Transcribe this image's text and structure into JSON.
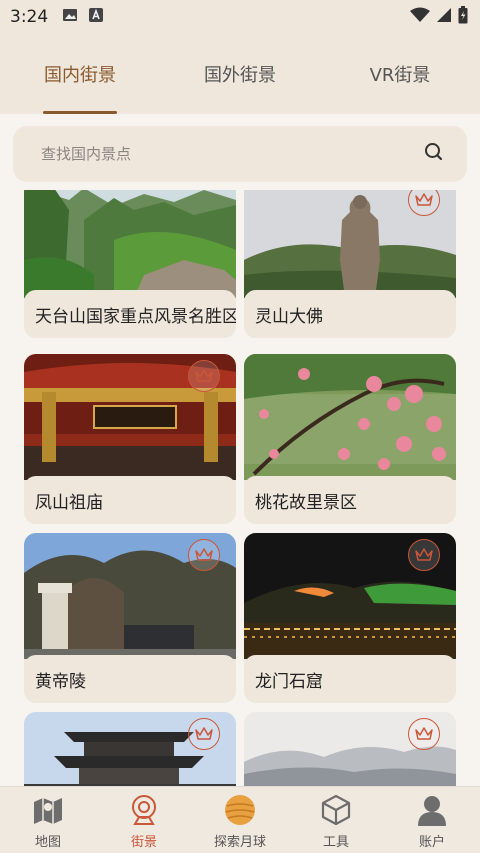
{
  "status": {
    "time": "3:24"
  },
  "tabs": [
    {
      "label": "国内街景",
      "active": true
    },
    {
      "label": "国外街景",
      "active": false
    },
    {
      "label": "VR街景",
      "active": false
    }
  ],
  "search": {
    "placeholder": "查找国内景点"
  },
  "spots": [
    {
      "name": "天台山国家重点风景名胜区",
      "premium": false
    },
    {
      "name": "灵山大佛",
      "premium": true
    },
    {
      "name": "凤山祖庙",
      "premium": true
    },
    {
      "name": "桃花故里景区",
      "premium": false
    },
    {
      "name": "黄帝陵",
      "premium": true
    },
    {
      "name": "龙门石窟",
      "premium": true
    },
    {
      "name": "",
      "premium": true
    },
    {
      "name": "",
      "premium": true
    }
  ],
  "nav": [
    {
      "label": "地图",
      "icon": "map-icon",
      "active": false
    },
    {
      "label": "街景",
      "icon": "street-view-icon",
      "active": true
    },
    {
      "label": "探索月球",
      "icon": "moon-icon",
      "active": false
    },
    {
      "label": "工具",
      "icon": "tools-cube-icon",
      "active": false
    },
    {
      "label": "账户",
      "icon": "account-icon",
      "active": false
    }
  ],
  "colors": {
    "accent": "#8a5a2f",
    "premium": "#c9573a",
    "surface": "#efe6dc"
  }
}
